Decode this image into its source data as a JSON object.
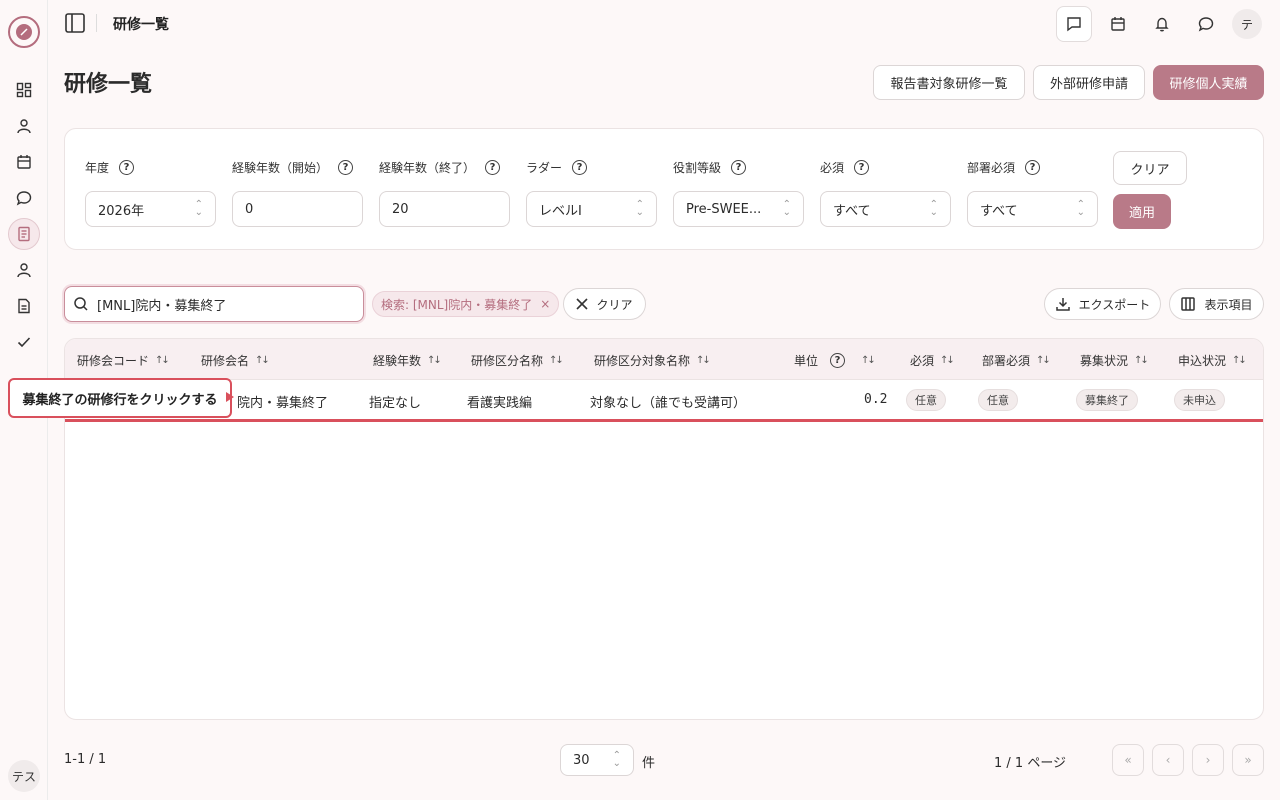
{
  "app": {
    "topbar_title": "研修一覧",
    "user_initial": "テ",
    "side_user": "テス"
  },
  "page": {
    "title": "研修一覧",
    "buttons": {
      "report_list": "報告書対象研修一覧",
      "external_apply": "外部研修申請",
      "personal_record": "研修個人実績"
    }
  },
  "filters": {
    "year": {
      "label": "年度",
      "value": "2026年"
    },
    "exp_start": {
      "label": "経験年数（開始）",
      "value": "0"
    },
    "exp_end": {
      "label": "経験年数（終了）",
      "value": "20"
    },
    "ladder": {
      "label": "ラダー",
      "value": "レベルI"
    },
    "role": {
      "label": "役割等級",
      "value": "Pre-SWEE..."
    },
    "required": {
      "label": "必須",
      "value": "すべて"
    },
    "dept_required": {
      "label": "部署必須",
      "value": "すべて"
    },
    "clear_label": "クリア",
    "apply_label": "適用"
  },
  "search": {
    "value": "[MNL]院内・募集終了",
    "chip": "検索: [MNL]院内・募集終了",
    "clear_label": "クリア",
    "export_label": "エクスポート",
    "columns_label": "表示項目"
  },
  "table": {
    "headers": [
      "研修会コード",
      "研修会名",
      "経験年数",
      "研修区分名称",
      "研修区分対象名称",
      "単位",
      "必須",
      "部署必須",
      "募集状況",
      "申込状況"
    ],
    "rows": [
      {
        "name": "院内・募集終了",
        "experience": "指定なし",
        "category": "看護実践編",
        "target": "対象なし（誰でも受講可）",
        "unit": "0.2",
        "required": "任意",
        "dept_required": "任意",
        "recruit_status": "募集終了",
        "apply_status": "未申込"
      }
    ]
  },
  "callout": {
    "text": "募集終了の研修行をクリックする"
  },
  "footer": {
    "count": "1-1 / 1",
    "page_size": "30",
    "page_size_unit": "件",
    "page_info": "1 / 1 ページ"
  },
  "colors": {
    "accent": "#b97a88",
    "highlight_red": "#d9505c"
  }
}
